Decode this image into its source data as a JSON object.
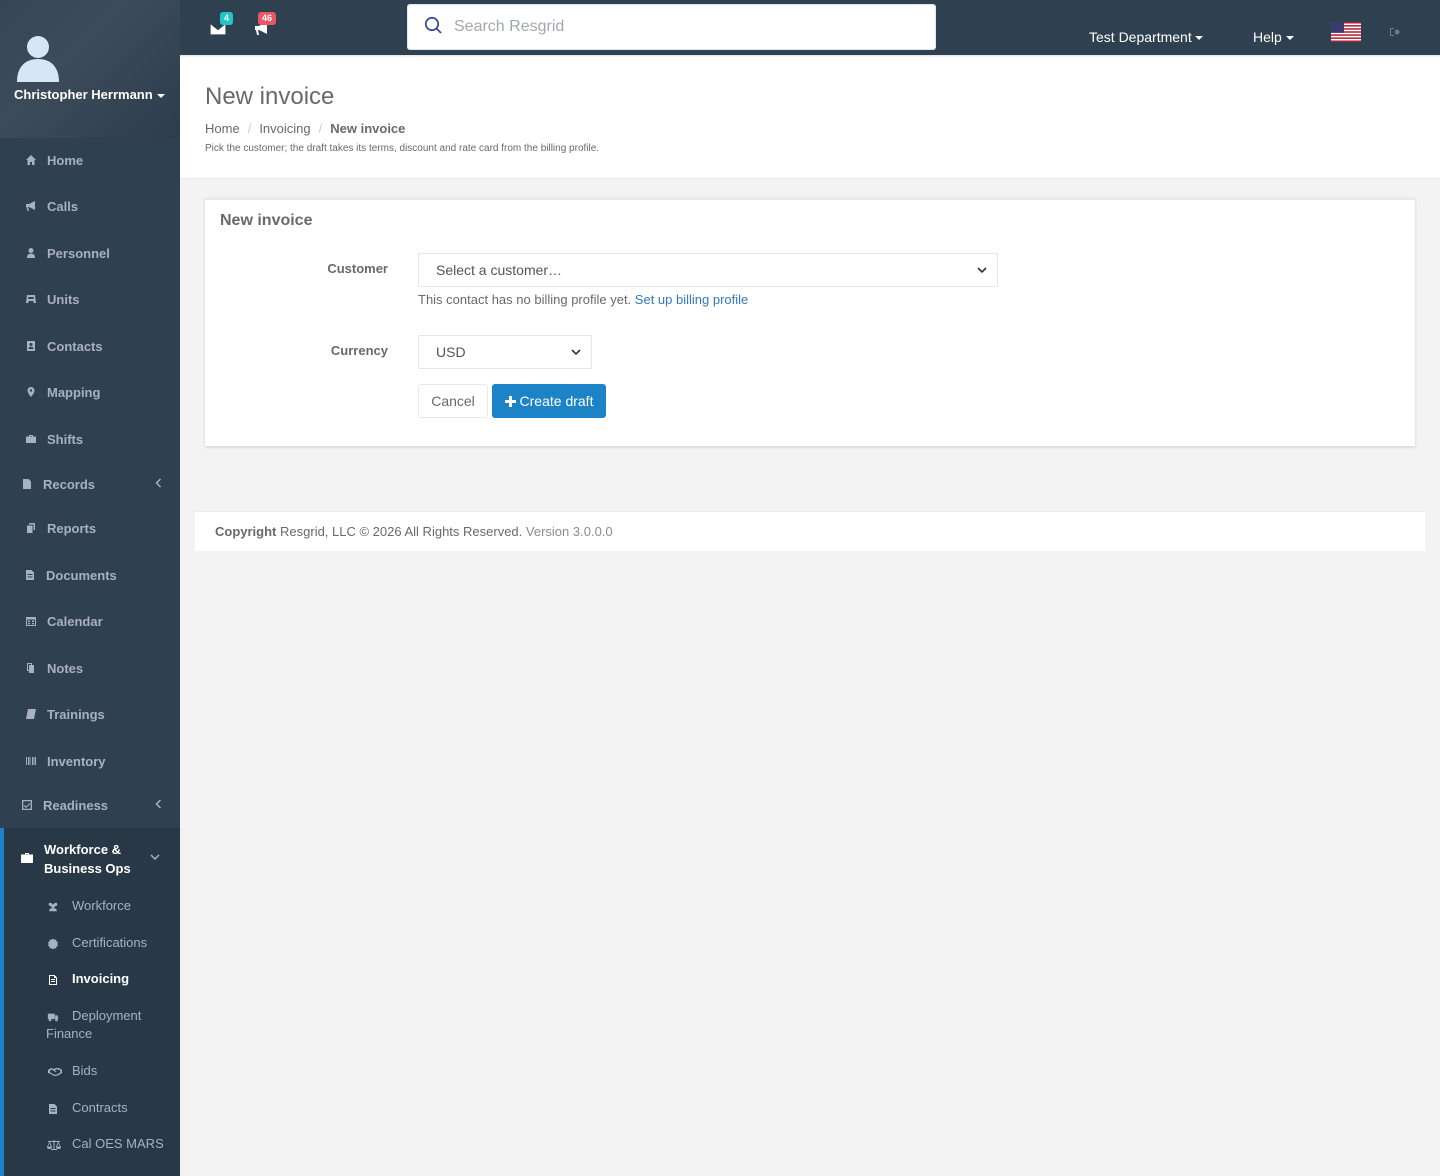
{
  "user": {
    "name": "Christopher Herrmann"
  },
  "nav": {
    "items": [
      {
        "label": "Home",
        "icon": "home-icon"
      },
      {
        "label": "Calls",
        "icon": "bullhorn-icon"
      },
      {
        "label": "Personnel",
        "icon": "user-icon"
      },
      {
        "label": "Units",
        "icon": "truck-icon"
      },
      {
        "label": "Contacts",
        "icon": "address-book-icon"
      },
      {
        "label": "Mapping",
        "icon": "map-marker-icon"
      },
      {
        "label": "Shifts",
        "icon": "briefcase-icon"
      },
      {
        "label": "Records",
        "icon": "file-icon"
      },
      {
        "label": "Reports",
        "icon": "copy-icon"
      },
      {
        "label": "Documents",
        "icon": "document-icon"
      },
      {
        "label": "Calendar",
        "icon": "calendar-icon"
      },
      {
        "label": "Notes",
        "icon": "notes-icon"
      },
      {
        "label": "Trainings",
        "icon": "book-icon"
      },
      {
        "label": "Inventory",
        "icon": "barcode-icon"
      },
      {
        "label": "Readiness",
        "icon": "check-square-icon"
      }
    ],
    "group": {
      "label": "Workforce & Business Ops",
      "icon": "briefcase-icon",
      "sub_items": [
        {
          "label": "Workforce",
          "icon": "users-icon"
        },
        {
          "label": "Certifications",
          "icon": "certificate-icon"
        },
        {
          "label": "Invoicing",
          "icon": "invoice-icon"
        },
        {
          "label": "Deployment",
          "label2": "Finance",
          "icon": "truck-icon"
        },
        {
          "label": "Bids",
          "icon": "handshake-icon"
        },
        {
          "label": "Contracts",
          "icon": "contract-icon"
        },
        {
          "label": "Cal OES MARS",
          "icon": "balance-scale-icon"
        }
      ]
    }
  },
  "topbar": {
    "messages_count": "4",
    "calls_count": "46",
    "search_placeholder": "Search Resgrid",
    "department": "Test Department",
    "help": "Help"
  },
  "page": {
    "title": "New invoice",
    "breadcrumb": [
      "Home",
      "Invoicing",
      "New invoice"
    ],
    "subtitle": "Pick the customer; the draft takes its terms, discount and rate card from the billing profile."
  },
  "form": {
    "panel_title": "New invoice",
    "customer_label": "Customer",
    "customer_value": "Select a customer…",
    "help_text": "This contact has no billing profile yet.",
    "help_link": "Set up billing profile",
    "currency_label": "Currency",
    "currency_value": "USD",
    "cancel_label": "Cancel",
    "create_label": "Create draft"
  },
  "footer": {
    "copyright_label": "Copyright",
    "copyright_text": "Resgrid, LLC © 2026 All Rights Reserved.",
    "version": "Version 3.0.0.0"
  },
  "colors": {
    "sidebar_bg": "#2f4050",
    "accent": "#1c84c6",
    "badge_messages": "#23c6c8",
    "badge_calls": "#ed5565",
    "link": "#337ab7"
  }
}
